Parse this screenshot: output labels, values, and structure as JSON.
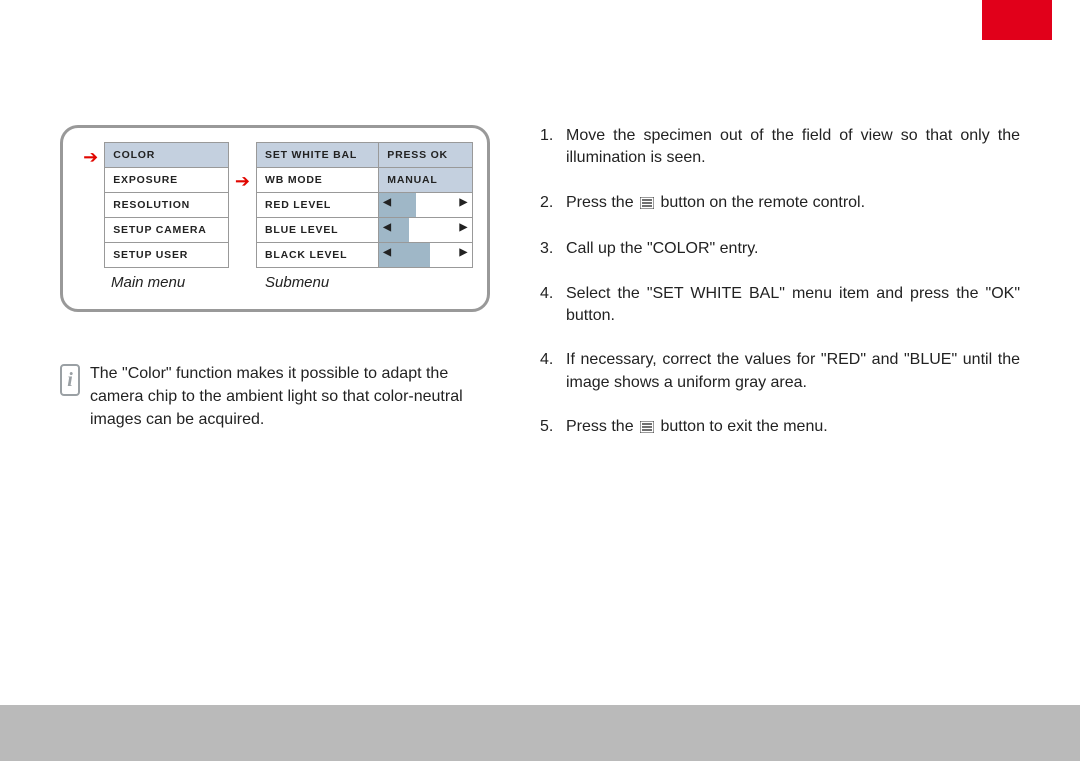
{
  "main_menu": {
    "items": [
      "COLOR",
      "EXPOSURE",
      "RESOLUTION",
      "SETUP CAMERA",
      "SETUP USER"
    ],
    "highlighted_index": 0,
    "caption": "Main menu"
  },
  "sub_menu": {
    "rows": [
      {
        "label": "SET WHITE BAL",
        "value": "PRESS OK",
        "type": "text",
        "hl_label": true,
        "hl_value": true
      },
      {
        "label": "WB MODE",
        "value": "MANUAL",
        "type": "text",
        "hl_label": false,
        "hl_value": true
      },
      {
        "label": "RED LEVEL",
        "type": "slider",
        "fill_pct": 40
      },
      {
        "label": "BLUE LEVEL",
        "type": "slider",
        "fill_pct": 32
      },
      {
        "label": "BLACK LEVEL",
        "type": "slider",
        "fill_pct": 55
      }
    ],
    "arrow_row_index": 1,
    "caption": "Submenu"
  },
  "info_text": "The \"Color\" function makes it possible to adapt the camera chip to the ambient light so that color-neutral images can be acquired.",
  "steps": [
    {
      "n": "1.",
      "t": "Move the specimen out of the field of view so that only the illumination is seen."
    },
    {
      "n": "2.",
      "t_before": "Press the ",
      "t_after": " button on the remote control.",
      "icon": true
    },
    {
      "n": "3.",
      "t": "Call up the \"COLOR\" entry."
    },
    {
      "n": "4.",
      "t": "Select the \"SET WHITE BAL\" menu item and press the \"OK\" button."
    },
    {
      "n": "4.",
      "t": "If necessary, correct the values for \"RED\" and \"BLUE\" until the image shows a uniform gray area."
    },
    {
      "n": "5.",
      "t_before": "Press the ",
      "t_after": " button to exit the menu.",
      "icon": true
    }
  ]
}
